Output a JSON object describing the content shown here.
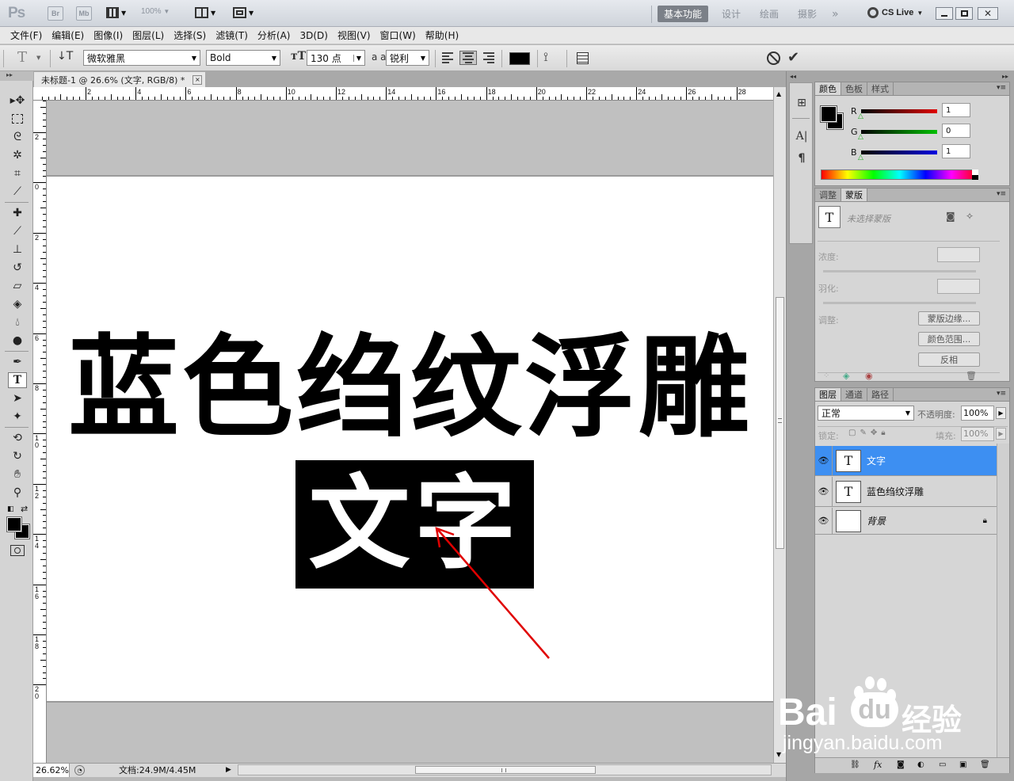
{
  "app": {
    "logo": "Ps",
    "bridge": "Br",
    "minibridge": "Mb",
    "zoom": "100%",
    "workspaces": [
      "基本功能",
      "设计",
      "绘画",
      "摄影"
    ],
    "more": "»",
    "cslive": "CS Live"
  },
  "menu": [
    "文件(F)",
    "编辑(E)",
    "图像(I)",
    "图层(L)",
    "选择(S)",
    "滤镜(T)",
    "分析(A)",
    "3D(D)",
    "视图(V)",
    "窗口(W)",
    "帮助(H)"
  ],
  "options": {
    "font_family": "微软雅黑",
    "font_style": "Bold",
    "font_size": "130 点",
    "antialias_label": "a a",
    "antialias": "锐利",
    "text_color": "#000000"
  },
  "document": {
    "tab_title": "未标题-1 @ 26.6% (文字, RGB/8) *",
    "close": "×",
    "title_text": "蓝色绉纹浮雕",
    "selected_text": "文字",
    "arrow_color": "#e00000",
    "ruler_top": [
      "2",
      "4",
      "6",
      "8",
      "10",
      "12",
      "14",
      "16",
      "18",
      "20",
      "22",
      "24",
      "26",
      "28"
    ],
    "ruler_left": [
      "2",
      "0",
      "2",
      "4",
      "6",
      "8",
      "10",
      "12",
      "14",
      "16",
      "18",
      "20"
    ]
  },
  "status": {
    "zoom": "26.62%",
    "doc_info": "文档:24.9M/4.45M"
  },
  "color_panel": {
    "tabs": [
      "颜色",
      "色板",
      "样式"
    ],
    "channels": [
      {
        "label": "R",
        "value": "1",
        "color": "#e00000"
      },
      {
        "label": "G",
        "value": "0",
        "color": "#00c000"
      },
      {
        "label": "B",
        "value": "1",
        "color": "#0000e0"
      }
    ]
  },
  "masks_panel": {
    "tabs": [
      "调整",
      "蒙版"
    ],
    "no_mask": "未选择蒙版",
    "density": "浓度:",
    "feather": "羽化:",
    "refine": "调整:",
    "buttons": [
      "蒙版边缘...",
      "颜色范围...",
      "反相"
    ]
  },
  "layers_panel": {
    "tabs": [
      "图层",
      "通道",
      "路径"
    ],
    "blend_mode": "正常",
    "opacity_label": "不透明度:",
    "opacity": "100%",
    "lock_label": "锁定:",
    "fill_label": "填充:",
    "fill": "100%",
    "layers": [
      {
        "name": "文字",
        "type": "T",
        "selected": true
      },
      {
        "name": "蓝色绉纹浮雕",
        "type": "T",
        "selected": false
      },
      {
        "name": "背景",
        "type": "",
        "selected": false
      }
    ]
  },
  "watermark": {
    "brand": "Bai",
    "brand2": "du",
    "cn": "经验",
    "url": "jingyan.baidu.com"
  }
}
